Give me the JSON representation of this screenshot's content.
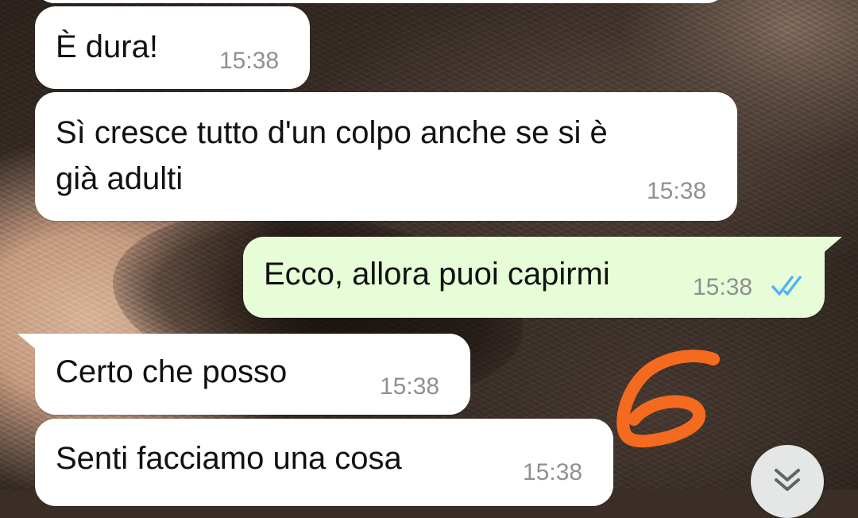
{
  "messages": [
    {
      "text": "È dura!",
      "time": "15:38",
      "direction": "in"
    },
    {
      "text": "Sì cresce tutto d'un colpo anche se si è\ngià adulti",
      "time": "15:38",
      "direction": "in"
    },
    {
      "text": "Ecco, allora puoi capirmi",
      "time": "15:38",
      "direction": "out",
      "status": "read"
    },
    {
      "text": "Certo che posso",
      "time": "15:38",
      "direction": "in"
    },
    {
      "text": "Senti facciamo una cosa",
      "time": "15:38",
      "direction": "in"
    }
  ],
  "annotation": {
    "text": "6",
    "color": "#f46a1f"
  },
  "colors": {
    "incoming_bubble": "#ffffff",
    "outgoing_bubble": "#e7fdd8",
    "read_ticks": "#4fb3f0",
    "timestamp": "#8d918f"
  },
  "icons": {
    "read_status": "double-check-icon",
    "scroll_down": "double-chevron-down-icon"
  }
}
